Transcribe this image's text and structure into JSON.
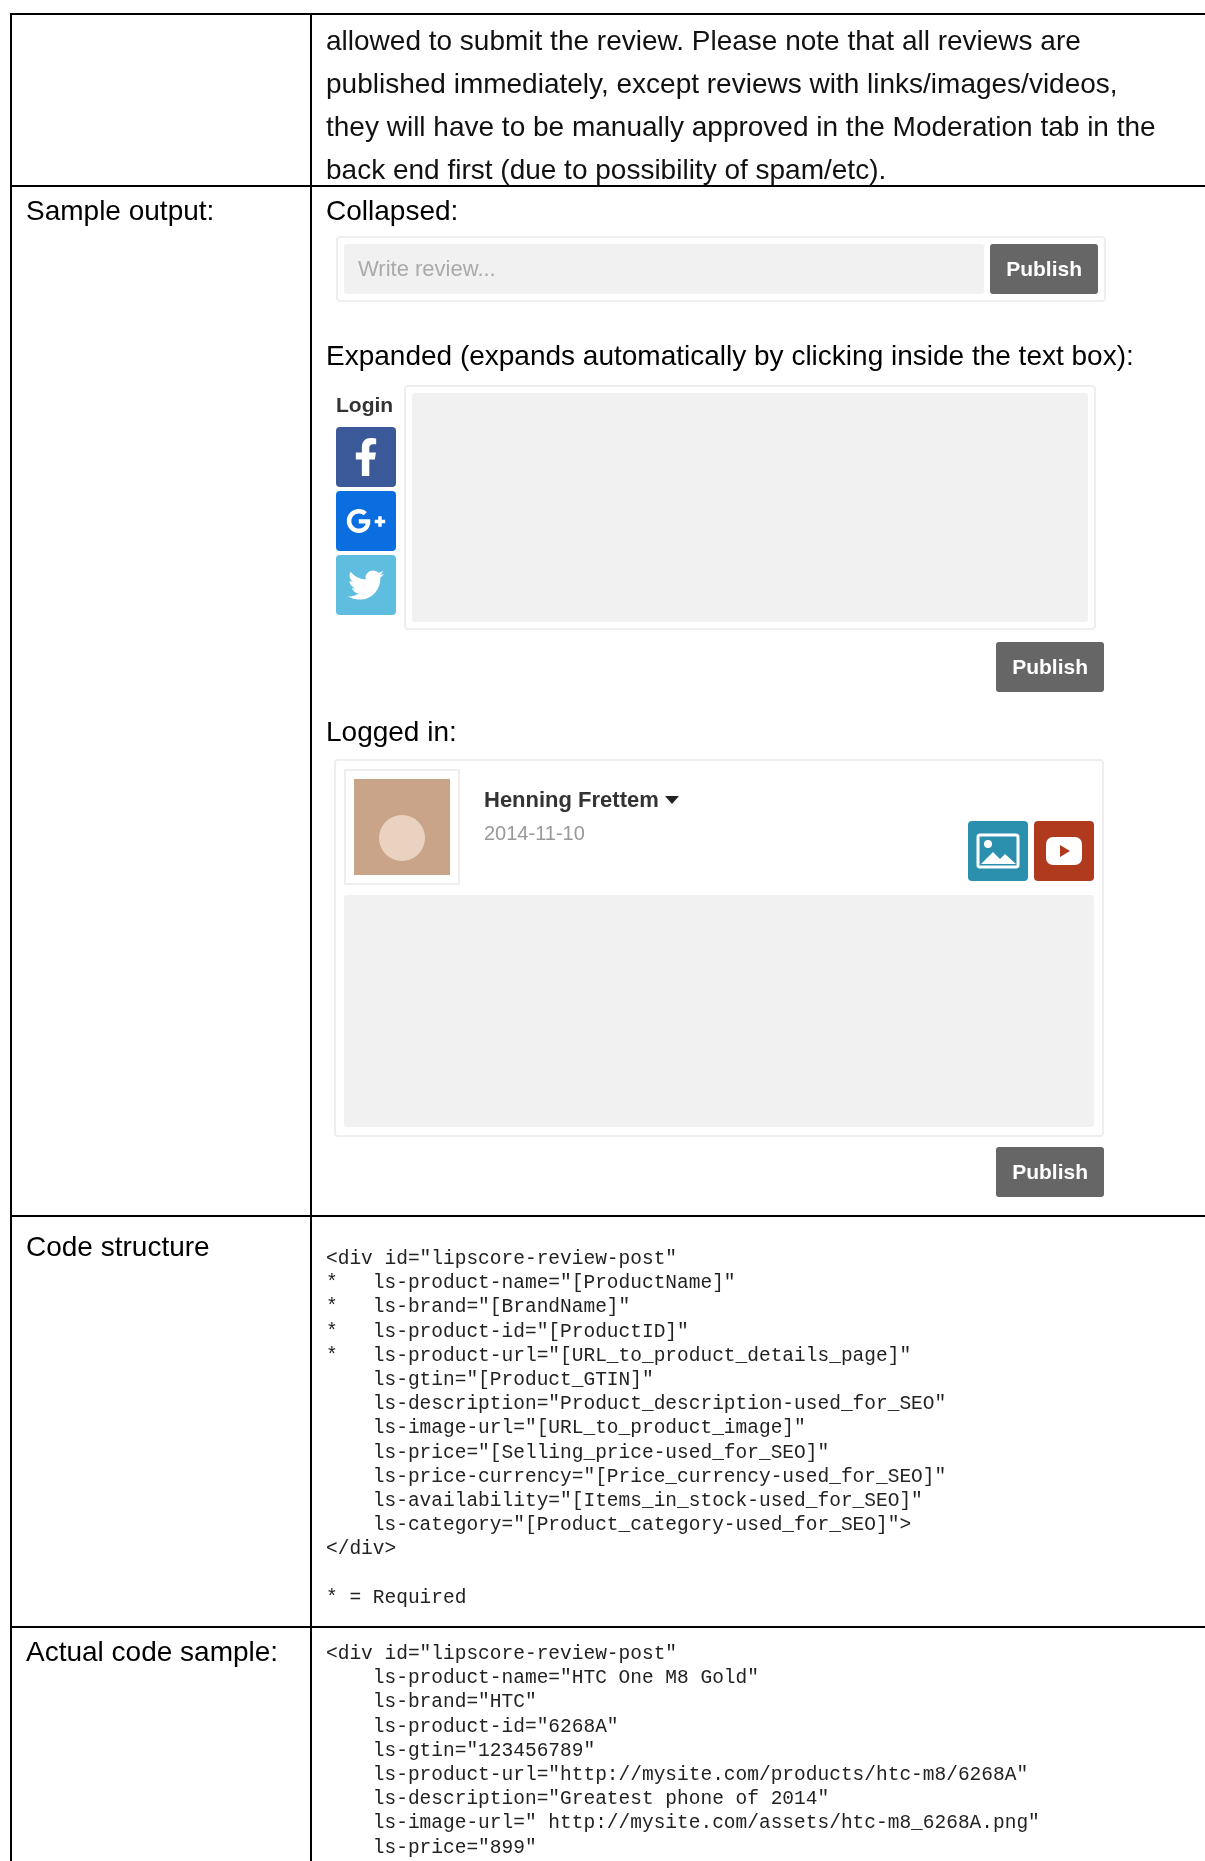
{
  "intro": {
    "text": "allowed to submit the review. Please note that all reviews are published immediately, except reviews with links/images/videos, they will have to be manually approved in the Moderation tab in the back end first (due to possibility of spam/etc)."
  },
  "sample_output": {
    "label": "Sample output:",
    "collapsed": {
      "caption": "Collapsed:",
      "placeholder": "Write review...",
      "button": "Publish"
    },
    "expanded": {
      "caption": "Expanded (expands automatically by clicking inside the text box):",
      "login_label": "Login",
      "button": "Publish"
    },
    "logged_in": {
      "caption": "Logged in:",
      "user_name": "Henning Frettem",
      "date": "2014-11-10",
      "button": "Publish"
    }
  },
  "code_structure": {
    "label": "Code structure",
    "lines": [
      "<div id=\"lipscore-review-post\"",
      "*   ls-product-name=\"[ProductName]\"",
      "*   ls-brand=\"[BrandName]\"",
      "*   ls-product-id=\"[ProductID]\"",
      "*   ls-product-url=\"[URL_to_product_details_page]\"",
      "    ls-gtin=\"[Product_GTIN]\"",
      "    ls-description=\"Product_description-used_for_SEO\"",
      "    ls-image-url=\"[URL_to_product_image]\"",
      "    ls-price=\"[Selling_price-used_for_SEO]\"",
      "    ls-price-currency=\"[Price_currency-used_for_SEO]\"",
      "    ls-availability=\"[Items_in_stock-used_for_SEO]\"",
      "    ls-category=\"[Product_category-used_for_SEO]\">",
      "</div>"
    ],
    "note": "* = Required"
  },
  "actual_code_sample": {
    "label": "Actual code sample:",
    "lines": [
      "<div id=\"lipscore-review-post\"",
      "    ls-product-name=\"HTC One M8 Gold\"",
      "    ls-brand=\"HTC\"",
      "    ls-product-id=\"6268A\"",
      "    ls-gtin=\"123456789\"",
      "    ls-product-url=\"http://mysite.com/products/htc-m8/6268A\"",
      "    ls-description=\"Greatest phone of 2014\"",
      "    ls-image-url=\" http://mysite.com/assets/htc-m8_6268A.png\"",
      "    ls-price=\"899\""
    ]
  }
}
